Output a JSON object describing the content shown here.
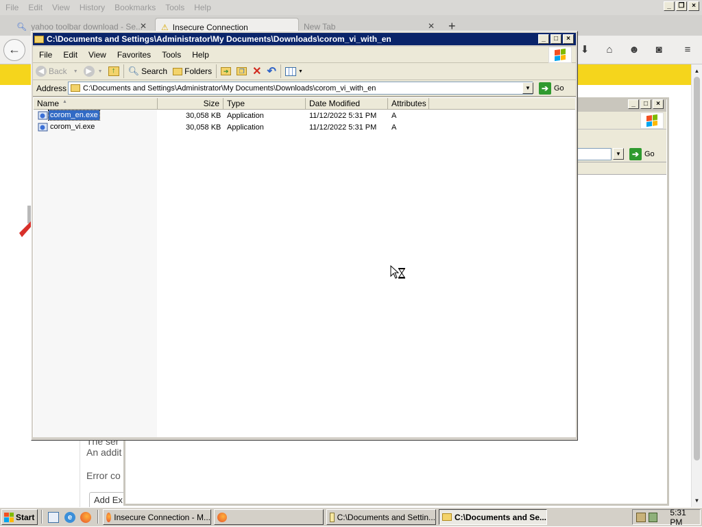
{
  "firefox": {
    "menu": [
      "File",
      "Edit",
      "View",
      "History",
      "Bookmarks",
      "Tools",
      "Help"
    ],
    "tabs": [
      {
        "label": "yahoo toolbar download - Se...",
        "active": false
      },
      {
        "label": "Insecure Connection",
        "active": true
      },
      {
        "label": "New Tab",
        "active": false
      }
    ],
    "new_tab_symbol": "+",
    "page_fragments": [
      "The ser",
      "An addit",
      "Error co",
      "Add Ex"
    ]
  },
  "explorer": {
    "title": "C:\\Documents and Settings\\Administrator\\My Documents\\Downloads\\corom_vi_with_en",
    "menu": [
      "File",
      "Edit",
      "View",
      "Favorites",
      "Tools",
      "Help"
    ],
    "toolbar": {
      "back": "Back",
      "search": "Search",
      "folders": "Folders"
    },
    "address_label": "Address",
    "address_value": "C:\\Documents and Settings\\Administrator\\My Documents\\Downloads\\corom_vi_with_en",
    "go_label": "Go",
    "columns": [
      "Name",
      "Size",
      "Type",
      "Date Modified",
      "Attributes"
    ],
    "files": [
      {
        "name": "corom_en.exe",
        "size": "30,058 KB",
        "type": "Application",
        "modified": "11/12/2022 5:31 PM",
        "attributes": "A",
        "selected": true
      },
      {
        "name": "corom_vi.exe",
        "size": "30,058 KB",
        "type": "Application",
        "modified": "11/12/2022 5:31 PM",
        "attributes": "A",
        "selected": false
      }
    ]
  },
  "background_window": {
    "go_label": "Go"
  },
  "taskbar": {
    "start_label": "Start",
    "tasks": [
      {
        "label": "Insecure Connection - M...",
        "pressed": false
      },
      {
        "label": "",
        "pressed": false
      },
      {
        "label": "C:\\Documents and Settin...",
        "pressed": false
      },
      {
        "label": "C:\\Documents and Se...",
        "pressed": true
      }
    ],
    "clock": "5:31 PM"
  },
  "colors": {
    "title_active": "#0a246a",
    "selection": "#316ac5",
    "banner_yellow": "#f5d51c",
    "window_face": "#ece9d8"
  }
}
